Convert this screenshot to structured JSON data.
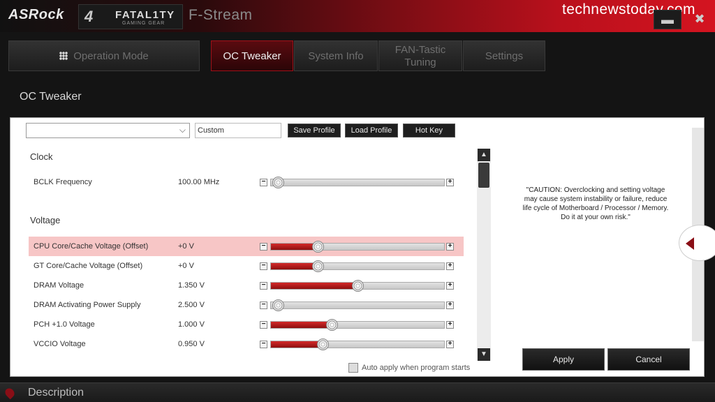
{
  "app": {
    "brand": "ASRock",
    "fatality_mark": "4",
    "fatality_title": "FATAL1TY",
    "fatality_sub": "GAMING GEAR",
    "name": "F-Stream",
    "watermark": "technewstoday.com",
    "minimize_glyph": "▬",
    "close_glyph": "✖"
  },
  "nav": {
    "tabs": [
      {
        "label": "Operation Mode",
        "icon": "grid-icon",
        "active": false
      },
      {
        "label": "OC Tweaker",
        "active": true
      },
      {
        "label": "System Info",
        "active": false
      },
      {
        "label": "FAN-Tastic Tuning",
        "active": false
      },
      {
        "label": "Settings",
        "active": false
      }
    ]
  },
  "section_title": "OC Tweaker",
  "profile": {
    "selected": "",
    "name_value": "Custom",
    "save_label": "Save Profile",
    "load_label": "Load Profile",
    "hotkey_label": "Hot Key"
  },
  "groups": {
    "clock": "Clock",
    "voltage": "Voltage"
  },
  "settings": [
    {
      "label": "BCLK Frequency",
      "value": "100.00 MHz",
      "level": 0.04,
      "filled": false
    },
    {
      "label": "CPU Core/Cache Voltage (Offset)",
      "value": "+0 V",
      "level": 0.27,
      "filled": true
    },
    {
      "label": "GT Core/Cache Voltage (Offset)",
      "value": "+0 V",
      "level": 0.27,
      "filled": true
    },
    {
      "label": "DRAM Voltage",
      "value": "1.350 V",
      "level": 0.5,
      "filled": true
    },
    {
      "label": "DRAM Activating Power Supply",
      "value": "2.500 V",
      "level": 0.04,
      "filled": false
    },
    {
      "label": "PCH +1.0 Voltage",
      "value": "1.000 V",
      "level": 0.35,
      "filled": true
    },
    {
      "label": "VCCIO Voltage",
      "value": "0.950 V",
      "level": 0.3,
      "filled": true
    }
  ],
  "auto_apply_label": "Auto apply when program starts",
  "caution_text": "\"CAUTION: Overclocking and setting voltage may cause system instability or failure, reduce life cycle of Motherboard / Processor / Memory. Do it at your own risk.\"",
  "apply_label": "Apply",
  "cancel_label": "Cancel",
  "description_label": "Description",
  "colors": {
    "accent": "#a01018",
    "fill": "#c42020",
    "highlight_row": "#f7c6c6"
  }
}
